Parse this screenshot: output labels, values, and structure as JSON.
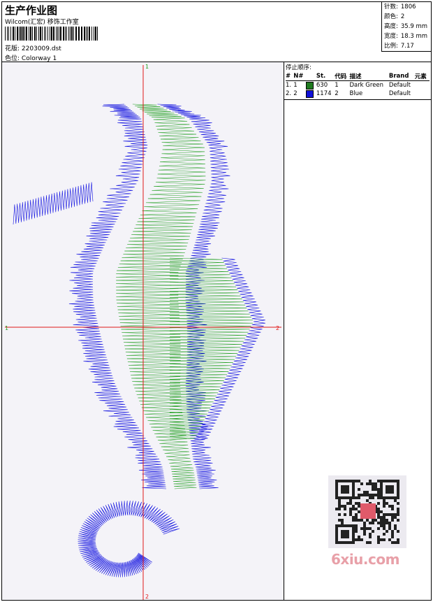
{
  "header": {
    "title": "生产作业图",
    "subtitle": "Wilcom(汇宏) 移饰工作室",
    "design_label": "花版:",
    "design_file": "2203009.dst",
    "colorway_label": "色位:",
    "colorway": "Colorway 1"
  },
  "stats": {
    "stitches_label": "针数:",
    "stitches": "1806",
    "colors_label": "颜色:",
    "colors": "2",
    "height_label": "高度:",
    "height": "35.9 mm",
    "width_label": "宽度:",
    "width": "18.3 mm",
    "scale_label": "比例:",
    "scale": "7.17"
  },
  "stop_sequence": {
    "title": "停止顺序:",
    "headers": [
      "#",
      "N#",
      "St.",
      "代码",
      "描述",
      "Brand",
      "元素"
    ],
    "rows": [
      {
        "index": "1.",
        "needle": "1",
        "stitches": "630",
        "code": "1",
        "description": "Dark Green",
        "brand": "Default",
        "color": "#1e7a1e"
      },
      {
        "index": "2.",
        "needle": "2",
        "stitches": "1174",
        "code": "2",
        "description": "Blue",
        "brand": "Default",
        "color": "#1010d8"
      }
    ]
  },
  "axis_labels": {
    "top": "1",
    "bottom": "2",
    "left": "1",
    "right": "2"
  },
  "watermark": "6xiu.com",
  "colors": {
    "axis_red": "#e01818",
    "axis_green": "#20a020",
    "thread_blue": "#1010e0",
    "thread_green": "#22a022"
  }
}
